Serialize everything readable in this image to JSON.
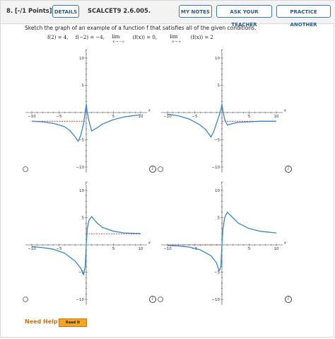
{
  "header": {
    "question_number": "8.",
    "points": "[-/1 Points]",
    "details_label": "DETAILS",
    "problem_code": "SCALCET9 2.6.005.",
    "my_notes_label": "MY NOTES",
    "ask_teacher_label": "ASK YOUR TEACHER",
    "practice_another_label": "PRACTICE ANOTHER"
  },
  "prompt": "Sketch the graph of an example of a function f that satisfies all of the given conditions.",
  "conditions": {
    "c1": "f(2) = 4,",
    "c2": "f(−2) = −4,",
    "c3_lim": "lim",
    "c3_sub": "x → −∞",
    "c3_expr": "(f(x)) = 0,",
    "c4_lim": "lim",
    "c4_sub": "x → ∞",
    "c4_expr": "(f(x)) = 2"
  },
  "axis": {
    "x_label": "x",
    "y_label": "y",
    "x_ticks": [
      "−10",
      "−5",
      "5",
      "10"
    ],
    "y_ticks": [
      "10",
      "5",
      "−5",
      "−10"
    ]
  },
  "chart_data": [
    {
      "type": "line",
      "xlim": [
        -10,
        10
      ],
      "ylim": [
        -10,
        10
      ],
      "asymptote_y": -1.6,
      "asymptote_side": "left",
      "x": [
        -10,
        -8,
        -6,
        -4,
        -3,
        -2,
        -1.5,
        -1,
        -0.5,
        -0.2,
        0,
        0.2,
        0.5,
        1,
        2,
        3,
        5,
        7,
        10
      ],
      "y": [
        -1.6,
        -1.7,
        -2.0,
        -2.6,
        -3.3,
        -4.5,
        -5.3,
        -4.2,
        -2.0,
        0.0,
        1.5,
        0.0,
        -1.5,
        -3.4,
        -2.8,
        -2.1,
        -1.3,
        -0.8,
        -0.4
      ]
    },
    {
      "type": "line",
      "xlim": [
        -10,
        10
      ],
      "ylim": [
        -10,
        10
      ],
      "asymptote_y": -1.6,
      "asymptote_side": "right",
      "x": [
        -10,
        -8,
        -6,
        -4,
        -3,
        -2,
        -1.5,
        -1,
        -0.5,
        -0.2,
        0,
        0.2,
        0.5,
        1,
        2,
        3,
        5,
        7,
        10
      ],
      "y": [
        -0.3,
        -0.6,
        -1.2,
        -2.3,
        -3.1,
        -4.5,
        -3.5,
        -2.0,
        -0.5,
        0.5,
        1.5,
        0.3,
        -1.3,
        -2.3,
        -2.0,
        -1.8,
        -1.7,
        -1.6,
        -1.6
      ]
    },
    {
      "type": "line",
      "xlim": [
        -10,
        10
      ],
      "ylim": [
        -10,
        10
      ],
      "asymptote_y": 2,
      "asymptote_side": "right",
      "x": [
        -10,
        -8,
        -6,
        -4,
        -2,
        -1,
        -0.5,
        -0.2,
        0,
        0.2,
        0.5,
        1,
        2,
        3,
        5,
        7,
        10
      ],
      "y": [
        -0.3,
        -0.5,
        -0.8,
        -1.5,
        -3.0,
        -4.3,
        -5.5,
        -4.0,
        0.0,
        3.0,
        4.5,
        5.2,
        4.0,
        3.2,
        2.5,
        2.2,
        2.05
      ]
    },
    {
      "type": "line",
      "xlim": [
        -10,
        10
      ],
      "ylim": [
        -10,
        10
      ],
      "asymptote_y": 0,
      "asymptote_side": "left",
      "x": [
        -10,
        -8,
        -6,
        -4,
        -2,
        -1,
        -0.5,
        -0.2,
        0,
        0.2,
        0.5,
        1,
        2,
        3,
        5,
        7,
        10
      ],
      "y": [
        -0.1,
        -0.2,
        -0.4,
        -0.9,
        -2.0,
        -3.3,
        -4.8,
        -4.0,
        0.0,
        3.0,
        5.0,
        6.0,
        5.0,
        4.0,
        3.0,
        2.5,
        2.2
      ]
    }
  ],
  "colors": {
    "curve": "#3a86c8",
    "asymptote": "#e02020",
    "button_border": "#3c78b4",
    "help": "#c8741e"
  },
  "help": {
    "need_help": "Need Help?",
    "read_it": "Read It"
  },
  "icons": {
    "info": "i"
  }
}
